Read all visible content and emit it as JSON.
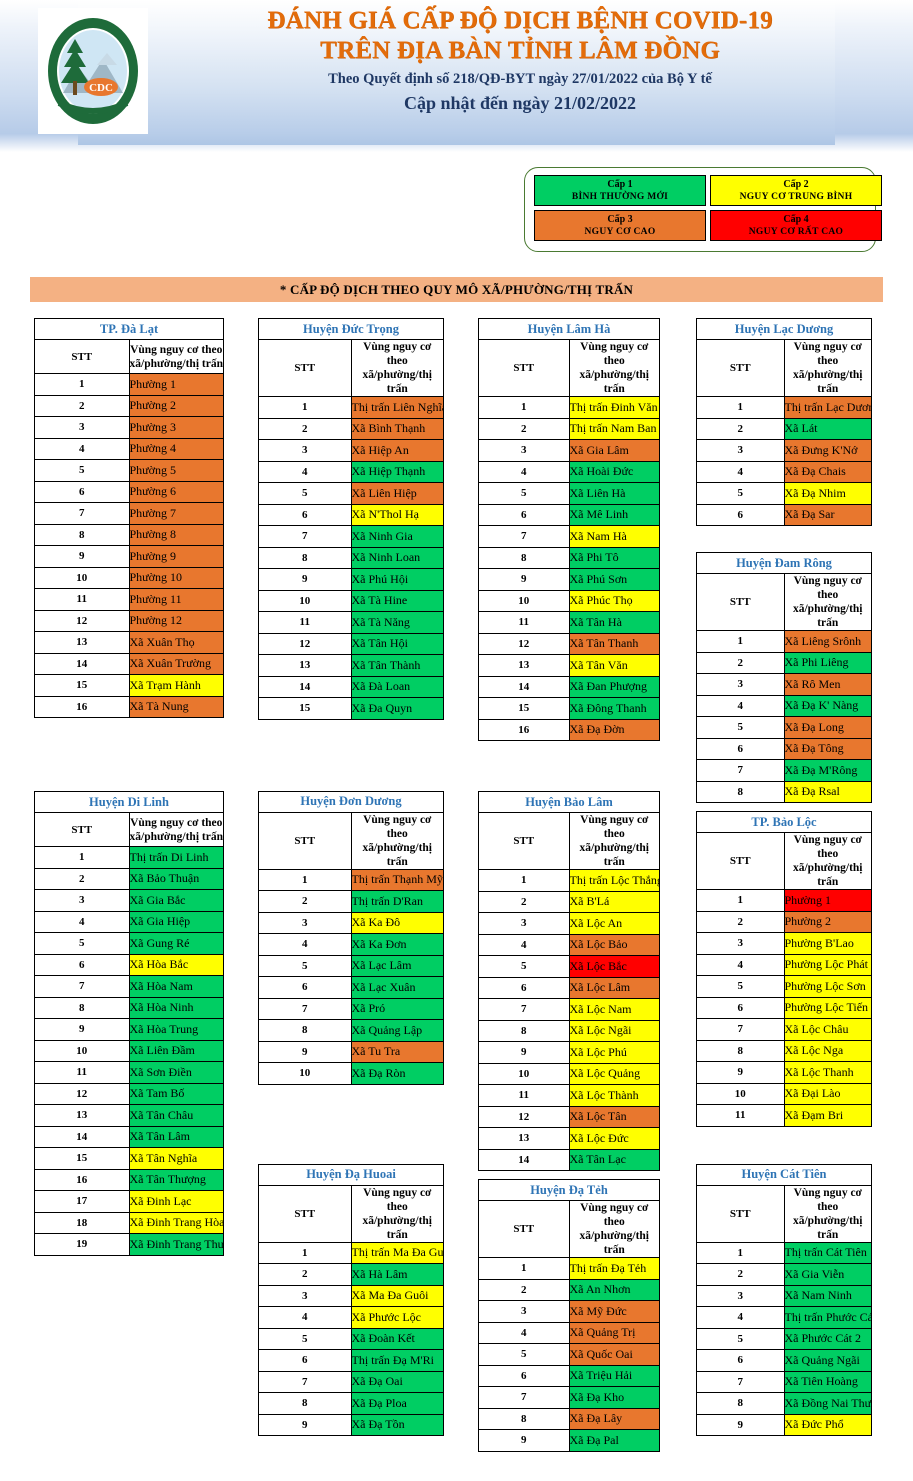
{
  "header": {
    "logo_alt": "cdc-lam-dong-logo",
    "title_line1": "ĐÁNH GIÁ CẤP ĐỘ DỊCH BỆNH COVID-19",
    "title_line2": "TRÊN ĐỊA BÀN TỈNH LÂM ĐỒNG",
    "subtitle": "Theo Quyết định  số 218/QĐ-BYT ngày 27/01/2022 của Bộ Y tế",
    "updated": "Cập nhật đến ngày 21/02/2022"
  },
  "legend": {
    "items": [
      {
        "level": "Cấp 1",
        "label": "BÌNH THƯỜNG MỚI",
        "color": "#00CE63",
        "class": "lv1"
      },
      {
        "level": "Cấp 2",
        "label": "NGUY CƠ TRUNG BÌNH",
        "color": "#FFFF00",
        "class": "lv2"
      },
      {
        "level": "Cấp 3",
        "label": "NGUY CƠ CAO",
        "color": "#E8772E",
        "class": "lv3"
      },
      {
        "level": "Cấp 4",
        "label": "NGUY CƠ RẤT CAO",
        "color": "#FF0000",
        "class": "lv4"
      }
    ]
  },
  "banner": {
    "text": "* CẤP ĐỘ DỊCH THEO QUY MÔ XÃ/PHƯỜNG/THỊ TRẤN",
    "color": "#F4B183"
  },
  "table_headers": {
    "stt": "STT",
    "zone_line1": "Vùng nguy cơ theo",
    "zone_line2": "xã/phường/thị trấn"
  },
  "districts": [
    {
      "id": "tp-da-lat",
      "name": "TP. Đà Lạt",
      "col": 1,
      "row": 1,
      "rows": [
        {
          "stt": "1",
          "name": "Phường 1",
          "level": 3
        },
        {
          "stt": "2",
          "name": "Phường 2",
          "level": 3
        },
        {
          "stt": "3",
          "name": "Phường 3",
          "level": 3
        },
        {
          "stt": "4",
          "name": "Phường 4",
          "level": 3
        },
        {
          "stt": "5",
          "name": "Phường 5",
          "level": 3
        },
        {
          "stt": "6",
          "name": "Phường 6",
          "level": 3
        },
        {
          "stt": "7",
          "name": "Phường 7",
          "level": 3
        },
        {
          "stt": "8",
          "name": "Phường 8",
          "level": 3
        },
        {
          "stt": "9",
          "name": "Phường 9",
          "level": 3
        },
        {
          "stt": "10",
          "name": "Phường 10",
          "level": 3
        },
        {
          "stt": "11",
          "name": "Phường 11",
          "level": 3
        },
        {
          "stt": "12",
          "name": "Phường 12",
          "level": 3
        },
        {
          "stt": "13",
          "name": "Xã Xuân Thọ",
          "level": 3
        },
        {
          "stt": "14",
          "name": "Xã Xuân Trường",
          "level": 3
        },
        {
          "stt": "15",
          "name": "Xã Trạm Hành",
          "level": 2
        },
        {
          "stt": "16",
          "name": "Xã Tà Nung",
          "level": 3
        }
      ]
    },
    {
      "id": "huyen-duc-trong",
      "name": "Huyện Đức Trọng",
      "col": 2,
      "row": 1,
      "rows": [
        {
          "stt": "1",
          "name": "Thị trấn Liên Nghĩa",
          "level": 3
        },
        {
          "stt": "2",
          "name": "Xã Bình Thạnh",
          "level": 3
        },
        {
          "stt": "3",
          "name": "Xã Hiệp An",
          "level": 3
        },
        {
          "stt": "4",
          "name": "Xã Hiệp Thạnh",
          "level": 1
        },
        {
          "stt": "5",
          "name": "Xã Liên Hiệp",
          "level": 3
        },
        {
          "stt": "6",
          "name": "Xã N'Thol Hạ",
          "level": 2
        },
        {
          "stt": "7",
          "name": "Xã Ninh Gia",
          "level": 1
        },
        {
          "stt": "8",
          "name": "Xã Ninh Loan",
          "level": 1
        },
        {
          "stt": "9",
          "name": "Xã Phú Hội",
          "level": 1
        },
        {
          "stt": "10",
          "name": "Xã Tà Hine",
          "level": 1
        },
        {
          "stt": "11",
          "name": "Xã Tà Năng",
          "level": 1
        },
        {
          "stt": "12",
          "name": "Xã Tân Hội",
          "level": 1
        },
        {
          "stt": "13",
          "name": "Xã Tân Thành",
          "level": 1
        },
        {
          "stt": "14",
          "name": "Xã Đà Loan",
          "level": 1
        },
        {
          "stt": "15",
          "name": "Xã Đa Quyn",
          "level": 1
        }
      ]
    },
    {
      "id": "huyen-lam-ha",
      "name": "Huyện Lâm Hà",
      "col": 3,
      "row": 1,
      "rows": [
        {
          "stt": "1",
          "name": "Thị trấn Đinh Văn",
          "level": 2
        },
        {
          "stt": "2",
          "name": "Thị trấn Nam Ban",
          "level": 2
        },
        {
          "stt": "3",
          "name": "Xã Gia Lâm",
          "level": 3
        },
        {
          "stt": "4",
          "name": "Xã Hoài Đức",
          "level": 1
        },
        {
          "stt": "5",
          "name": "Xã Liên Hà",
          "level": 1
        },
        {
          "stt": "6",
          "name": "Xã Mê Linh",
          "level": 1
        },
        {
          "stt": "7",
          "name": "Xã Nam Hà",
          "level": 2
        },
        {
          "stt": "8",
          "name": "Xã Phi Tô",
          "level": 1
        },
        {
          "stt": "9",
          "name": "Xã Phú Sơn",
          "level": 1
        },
        {
          "stt": "10",
          "name": "Xã Phúc Thọ",
          "level": 2
        },
        {
          "stt": "11",
          "name": "Xã Tân Hà",
          "level": 1
        },
        {
          "stt": "12",
          "name": "Xã Tân Thanh",
          "level": 3
        },
        {
          "stt": "13",
          "name": "Xã Tân Văn",
          "level": 2
        },
        {
          "stt": "14",
          "name": "Xã Đan Phượng",
          "level": 1
        },
        {
          "stt": "15",
          "name": "Xã Đông Thanh",
          "level": 1
        },
        {
          "stt": "16",
          "name": "Xã Đạ Đờn",
          "level": 3
        }
      ]
    },
    {
      "id": "huyen-lac-duong",
      "name": "Huyện Lạc Dương",
      "col": 4,
      "row": 1,
      "rows": [
        {
          "stt": "1",
          "name": "Thị trấn Lạc Dương",
          "level": 3
        },
        {
          "stt": "2",
          "name": "Xã Lát",
          "level": 1
        },
        {
          "stt": "3",
          "name": "Xã Đưng K'Nớ",
          "level": 3
        },
        {
          "stt": "4",
          "name": "Xã Đạ Chais",
          "level": 3
        },
        {
          "stt": "5",
          "name": "Xã Đạ Nhim",
          "level": 2
        },
        {
          "stt": "6",
          "name": "Xã Đạ Sar",
          "level": 3
        }
      ]
    },
    {
      "id": "huyen-dam-rong",
      "name": "Huyện Đam Rông",
      "col": 4,
      "row": 1.5,
      "rows": [
        {
          "stt": "1",
          "name": "Xã Liêng Srônh",
          "level": 3
        },
        {
          "stt": "2",
          "name": "Xã Phi Liêng",
          "level": 1
        },
        {
          "stt": "3",
          "name": "Xã Rô Men",
          "level": 3
        },
        {
          "stt": "4",
          "name": "Xã Đạ K' Nàng",
          "level": 1
        },
        {
          "stt": "5",
          "name": "Xã Đạ Long",
          "level": 3
        },
        {
          "stt": "6",
          "name": "Xã Đạ Tông",
          "level": 3
        },
        {
          "stt": "7",
          "name": "Xã Đạ M'Rông",
          "level": 1
        },
        {
          "stt": "8",
          "name": "Xã Đạ Rsal",
          "level": 2
        }
      ]
    },
    {
      "id": "huyen-di-linh",
      "name": "Huyện Di Linh",
      "col": 1,
      "row": 2,
      "rows": [
        {
          "stt": "1",
          "name": "Thị trấn Di Linh",
          "level": 1
        },
        {
          "stt": "2",
          "name": "Xã Bảo Thuận",
          "level": 1
        },
        {
          "stt": "3",
          "name": "Xã Gia Bắc",
          "level": 1
        },
        {
          "stt": "4",
          "name": "Xã Gia Hiệp",
          "level": 1
        },
        {
          "stt": "5",
          "name": "Xã Gung Ré",
          "level": 1
        },
        {
          "stt": "6",
          "name": "Xã Hòa Bắc",
          "level": 2
        },
        {
          "stt": "7",
          "name": "Xã Hòa Nam",
          "level": 1
        },
        {
          "stt": "8",
          "name": "Xã Hòa Ninh",
          "level": 1
        },
        {
          "stt": "9",
          "name": "Xã Hòa Trung",
          "level": 1
        },
        {
          "stt": "10",
          "name": "Xã Liên Đầm",
          "level": 1
        },
        {
          "stt": "11",
          "name": "Xã Sơn Điền",
          "level": 1
        },
        {
          "stt": "12",
          "name": "Xã Tam Bố",
          "level": 1
        },
        {
          "stt": "13",
          "name": "Xã Tân Châu",
          "level": 1
        },
        {
          "stt": "14",
          "name": "Xã Tân Lâm",
          "level": 1
        },
        {
          "stt": "15",
          "name": "Xã Tân Nghĩa",
          "level": 2
        },
        {
          "stt": "16",
          "name": "Xã Tân Thượng",
          "level": 1
        },
        {
          "stt": "17",
          "name": "Xã Đinh Lạc",
          "level": 2
        },
        {
          "stt": "18",
          "name": "Xã Đinh Trang Hòa",
          "level": 2
        },
        {
          "stt": "19",
          "name": "Xã Đinh Trang Thượng",
          "level": 1
        }
      ]
    },
    {
      "id": "huyen-don-duong",
      "name": "Huyện Đơn Dương",
      "col": 2,
      "row": 2,
      "rows": [
        {
          "stt": "1",
          "name": "Thị trấn Thạnh Mỹ",
          "level": 3
        },
        {
          "stt": "2",
          "name": "Thị trấn D'Ran",
          "level": 1
        },
        {
          "stt": "3",
          "name": "Xã Ka Đô",
          "level": 2
        },
        {
          "stt": "4",
          "name": "Xã Ka Đơn",
          "level": 1
        },
        {
          "stt": "5",
          "name": "Xã Lạc Lâm",
          "level": 1
        },
        {
          "stt": "6",
          "name": "Xã Lạc Xuân",
          "level": 1
        },
        {
          "stt": "7",
          "name": "Xã Pró",
          "level": 1
        },
        {
          "stt": "8",
          "name": "Xã Quảng Lập",
          "level": 1
        },
        {
          "stt": "9",
          "name": "Xã Tu Tra",
          "level": 3
        },
        {
          "stt": "10",
          "name": "Xã Đạ Ròn",
          "level": 1
        }
      ]
    },
    {
      "id": "huyen-bao-lam",
      "name": "Huyện Bảo Lâm",
      "col": 3,
      "row": 2,
      "rows": [
        {
          "stt": "1",
          "name": "Thị trấn Lộc Thắng",
          "level": 2
        },
        {
          "stt": "2",
          "name": "Xã B'Lá",
          "level": 2
        },
        {
          "stt": "3",
          "name": "Xã Lộc An",
          "level": 2
        },
        {
          "stt": "4",
          "name": "Xã Lộc Bảo",
          "level": 3
        },
        {
          "stt": "5",
          "name": "Xã Lộc Bắc",
          "level": 4
        },
        {
          "stt": "6",
          "name": "Xã Lộc Lâm",
          "level": 3
        },
        {
          "stt": "7",
          "name": "Xã Lộc Nam",
          "level": 2
        },
        {
          "stt": "8",
          "name": "Xã Lộc Ngãi",
          "level": 2
        },
        {
          "stt": "9",
          "name": "Xã Lộc Phú",
          "level": 2
        },
        {
          "stt": "10",
          "name": "Xã Lộc Quảng",
          "level": 2
        },
        {
          "stt": "11",
          "name": "Xã Lộc Thành",
          "level": 2
        },
        {
          "stt": "12",
          "name": "Xã Lộc Tân",
          "level": 3
        },
        {
          "stt": "13",
          "name": "Xã Lộc Đức",
          "level": 2
        },
        {
          "stt": "14",
          "name": "Xã Tân Lạc",
          "level": 1
        }
      ]
    },
    {
      "id": "tp-bao-loc",
      "name": "TP. Bảo Lộc",
      "col": 4,
      "row": 2,
      "rows": [
        {
          "stt": "1",
          "name": "Phường 1",
          "level": 4
        },
        {
          "stt": "2",
          "name": "Phường 2",
          "level": 3
        },
        {
          "stt": "3",
          "name": "Phường B'Lao",
          "level": 2
        },
        {
          "stt": "4",
          "name": "Phường Lộc Phát",
          "level": 2
        },
        {
          "stt": "5",
          "name": "Phường Lộc Sơn",
          "level": 2
        },
        {
          "stt": "6",
          "name": "Phường Lộc Tiến",
          "level": 2
        },
        {
          "stt": "7",
          "name": "Xã Lộc Châu",
          "level": 2
        },
        {
          "stt": "8",
          "name": "Xã Lộc Nga",
          "level": 2
        },
        {
          "stt": "9",
          "name": "Xã Lộc Thanh",
          "level": 2
        },
        {
          "stt": "10",
          "name": "Xã Đại Lào",
          "level": 2
        },
        {
          "stt": "11",
          "name": "Xã Đạm Bri",
          "level": 2
        }
      ]
    },
    {
      "id": "huyen-da-huoai",
      "name": "Huyện Đạ Huoai",
      "col": 2,
      "row": 3,
      "rows": [
        {
          "stt": "1",
          "name": "Thị trấn Ma Đa Guôi",
          "level": 2
        },
        {
          "stt": "2",
          "name": "Xã Hà Lâm",
          "level": 1
        },
        {
          "stt": "3",
          "name": "Xã Ma Đa Guôi",
          "level": 2
        },
        {
          "stt": "4",
          "name": "Xã Phước Lộc",
          "level": 2
        },
        {
          "stt": "5",
          "name": "Xã Đoàn Kết",
          "level": 1
        },
        {
          "stt": "6",
          "name": "Thị trấn Đạ M'Ri",
          "level": 1
        },
        {
          "stt": "7",
          "name": "Xã Đạ Oai",
          "level": 1
        },
        {
          "stt": "8",
          "name": "Xã Đạ Ploa",
          "level": 1
        },
        {
          "stt": "9",
          "name": "Xã Đạ Tồn",
          "level": 1
        }
      ]
    },
    {
      "id": "huyen-da-teh",
      "name": "Huyện Đạ Tẻh",
      "col": 3,
      "row": 3,
      "rows": [
        {
          "stt": "1",
          "name": "Thị trấn Đạ Tẻh",
          "level": 2
        },
        {
          "stt": "2",
          "name": "Xã An Nhơn",
          "level": 1
        },
        {
          "stt": "3",
          "name": "Xã Mỹ Đức",
          "level": 3
        },
        {
          "stt": "4",
          "name": "Xã Quảng Trị",
          "level": 3
        },
        {
          "stt": "5",
          "name": "Xã Quốc Oai",
          "level": 3
        },
        {
          "stt": "6",
          "name": "Xã Triệu Hải",
          "level": 1
        },
        {
          "stt": "7",
          "name": "Xã Đạ Kho",
          "level": 1
        },
        {
          "stt": "8",
          "name": "Xã Đạ Lây",
          "level": 3
        },
        {
          "stt": "9",
          "name": "Xã Đạ Pal",
          "level": 1
        }
      ]
    },
    {
      "id": "huyen-cat-tien",
      "name": "Huyện Cát Tiên",
      "col": 4,
      "row": 3,
      "rows": [
        {
          "stt": "1",
          "name": "Thị trấn Cát Tiên",
          "level": 1
        },
        {
          "stt": "2",
          "name": "Xã Gia Viễn",
          "level": 1
        },
        {
          "stt": "3",
          "name": "Xã Nam Ninh",
          "level": 1
        },
        {
          "stt": "4",
          "name": "Thị trấn Phước Cát",
          "level": 1
        },
        {
          "stt": "5",
          "name": "Xã Phước Cát 2",
          "level": 1
        },
        {
          "stt": "6",
          "name": "Xã Quảng Ngãi",
          "level": 1
        },
        {
          "stt": "7",
          "name": "Xã Tiên Hoàng",
          "level": 1
        },
        {
          "stt": "8",
          "name": "Xã Đồng Nai Thượng",
          "level": 1
        },
        {
          "stt": "9",
          "name": "Xã Đức Phổ",
          "level": 2
        }
      ]
    }
  ]
}
